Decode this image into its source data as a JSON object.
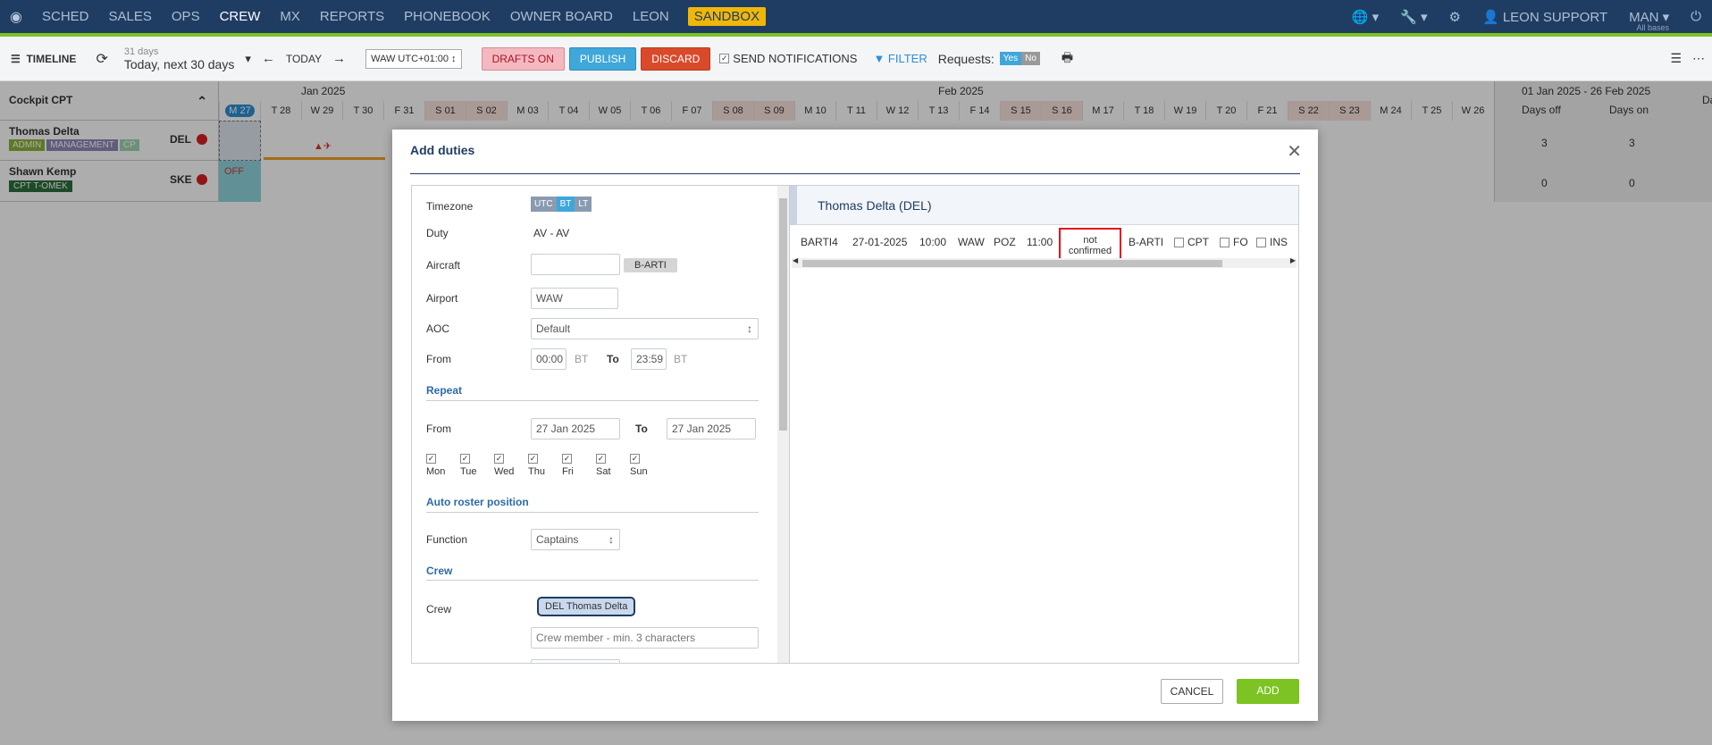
{
  "nav": {
    "items": [
      "SCHED",
      "SALES",
      "OPS",
      "CREW",
      "MX",
      "REPORTS",
      "PHONEBOOK",
      "OWNER BOARD",
      "LEON"
    ],
    "active": "CREW",
    "sandbox": "SANDBOX",
    "user": "LEON SUPPORT",
    "base": "MAN",
    "all_bases": "All bases"
  },
  "toolbar": {
    "timeline": "TIMELINE",
    "range_days": "31 days",
    "range_label": "Today, next 30 days",
    "today": "TODAY",
    "timezone": "WAW UTC+01:00",
    "drafts": "DRAFTS ON",
    "publish": "PUBLISH",
    "discard": "DISCARD",
    "send_notifications": "SEND NOTIFICATIONS",
    "filter": "FILTER",
    "requests": "Requests:",
    "yes": "Yes",
    "no": "No"
  },
  "grid": {
    "group": "Cockpit CPT",
    "month1": "Jan 2025",
    "month2": "Feb 2025",
    "summary_range": "01 Jan 2025 - 26 Feb 2025",
    "days_off": "Days off",
    "days_on": "Days on",
    "da": "Da",
    "days": [
      "M 27",
      "T 28",
      "W 29",
      "T 30",
      "F 31",
      "S 01",
      "S 02",
      "M 03",
      "T 04",
      "W 05",
      "T 06",
      "F 07",
      "S 08",
      "S 09",
      "M 10",
      "T 11",
      "W 12",
      "T 13",
      "F 14",
      "S 15",
      "S 16",
      "M 17",
      "T 18",
      "W 19",
      "T 20",
      "F 21",
      "S 22",
      "S 23",
      "M 24",
      "T 25",
      "W 26"
    ],
    "crew": [
      {
        "name": "Thomas Delta",
        "code": "DEL",
        "tags": [
          "ADMIN",
          "MANAGEMENT",
          "CP"
        ],
        "days_off": "3",
        "days_on": "3"
      },
      {
        "name": "Shawn Kemp",
        "code": "SKE",
        "tags": [
          "CPT T-OMEK"
        ],
        "days_off": "0",
        "days_on": "0",
        "duty": "OFF"
      }
    ]
  },
  "modal": {
    "title": "Add duties",
    "timezone_label": "Timezone",
    "tz": [
      "UTC",
      "BT",
      "LT"
    ],
    "duty_label": "Duty",
    "duty_value": "AV - AV",
    "aircraft_label": "Aircraft",
    "aircraft_tag": "B-ARTI",
    "airport_label": "Airport",
    "airport_value": "WAW",
    "aoc_label": "AOC",
    "aoc_value": "Default",
    "from_label": "From",
    "from_time": "00:00",
    "bt": "BT",
    "to_label": "To",
    "to_time": "23:59",
    "repeat": "Repeat",
    "repeat_from": "27 Jan 2025",
    "repeat_to": "27 Jan 2025",
    "weekdays": [
      "Mon",
      "Tue",
      "Wed",
      "Thu",
      "Fri",
      "Sat",
      "Sun"
    ],
    "auto_roster": "Auto roster position",
    "function_label": "Function",
    "function_value": "Captains",
    "crew_section": "Crew",
    "crew_label": "Crew",
    "crew_chip": "DEL Thomas Delta",
    "crew_placeholder": "Crew member - min. 3 characters",
    "cancel": "CANCEL",
    "add": "ADD",
    "right": {
      "header": "Thomas Delta (DEL)",
      "cols": [
        "BARTI4",
        "27-01-2025",
        "10:00",
        "WAW",
        "POZ",
        "11:00"
      ],
      "status1": "not",
      "status2": "confirmed",
      "reg": "B-ARTI",
      "roles": [
        "CPT",
        "FO",
        "INS"
      ]
    }
  }
}
